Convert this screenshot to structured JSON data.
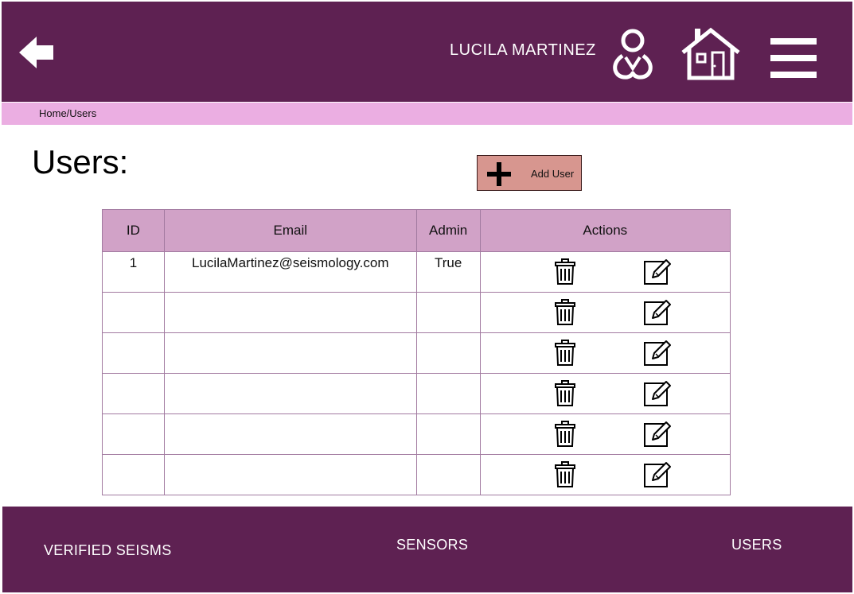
{
  "header": {
    "user_name": "LUCILA MARTINEZ",
    "background": "#5e2152"
  },
  "breadcrumb": {
    "text": "Home/Users"
  },
  "main": {
    "title": "Users:",
    "add_user_label": "Add User"
  },
  "table": {
    "columns": [
      "ID",
      "Email",
      "Admin",
      "Actions"
    ],
    "rows": [
      {
        "id": "1",
        "email": "LucilaMartinez@seismology.com",
        "admin": "True"
      },
      {
        "id": "",
        "email": "",
        "admin": ""
      },
      {
        "id": "",
        "email": "",
        "admin": ""
      },
      {
        "id": "",
        "email": "",
        "admin": ""
      },
      {
        "id": "",
        "email": "",
        "admin": ""
      },
      {
        "id": "",
        "email": "",
        "admin": ""
      }
    ]
  },
  "footer": {
    "links": [
      "VERIFIED SEISMS",
      "SENSORS",
      "USERS"
    ]
  },
  "icons": {
    "back": "back-arrow-icon",
    "profile": "user-profile-icon",
    "home": "home-icon",
    "menu": "hamburger-menu-icon",
    "add": "plus-icon",
    "delete": "trash-icon",
    "edit": "edit-icon"
  },
  "colors": {
    "primary": "#5e2152",
    "breadcrumb_bg": "#ebaee2",
    "table_header_bg": "#d1a2c7",
    "add_button_bg": "#d7968f"
  }
}
